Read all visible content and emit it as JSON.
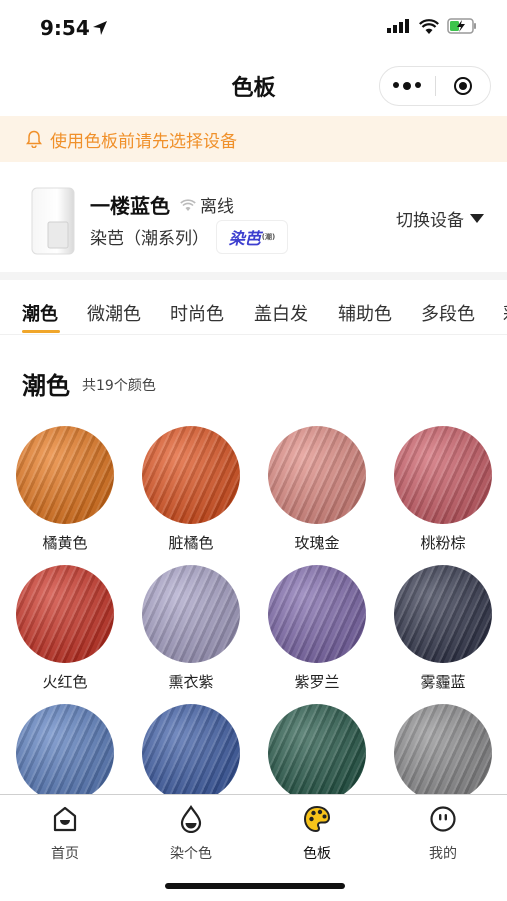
{
  "status_bar": {
    "time": "9:54"
  },
  "nav": {
    "title": "色板"
  },
  "notice": {
    "text": "使用色板前请先选择设备"
  },
  "device": {
    "name": "一楼蓝色",
    "status": "离线",
    "model": "染芭（潮系列）",
    "brand_logo": "染芭",
    "brand_sub": "潮",
    "switch_label": "切换设备"
  },
  "tabs": [
    {
      "label": "潮色",
      "active": true
    },
    {
      "label": "微潮色"
    },
    {
      "label": "时尚色"
    },
    {
      "label": "盖白发"
    },
    {
      "label": "辅助色"
    },
    {
      "label": "多段色"
    },
    {
      "label": "彩"
    }
  ],
  "section": {
    "title": "潮色",
    "count": "共19个颜色"
  },
  "colors": [
    {
      "name": "橘黄色",
      "color": "#e8771c"
    },
    {
      "name": "脏橘色",
      "color": "#e0521e"
    },
    {
      "name": "玫瑰金",
      "color": "#e08a82"
    },
    {
      "name": "桃粉棕",
      "color": "#cc5c66"
    },
    {
      "name": "火红色",
      "color": "#cc3224"
    },
    {
      "name": "熏衣紫",
      "color": "#a8a2c8"
    },
    {
      "name": "紫罗兰",
      "color": "#7e68ac"
    },
    {
      "name": "雾霾蓝",
      "color": "#32364c"
    },
    {
      "name": "",
      "color": "#5a7ec0"
    },
    {
      "name": "",
      "color": "#3c5ca6"
    },
    {
      "name": "",
      "color": "#245848"
    },
    {
      "name": "",
      "color": "#8c8c8e"
    }
  ],
  "tabbar": [
    {
      "label": "首页",
      "icon": "home-icon"
    },
    {
      "label": "染个色",
      "icon": "drop-icon"
    },
    {
      "label": "色板",
      "icon": "palette-icon",
      "active": true
    },
    {
      "label": "我的",
      "icon": "profile-icon"
    }
  ]
}
